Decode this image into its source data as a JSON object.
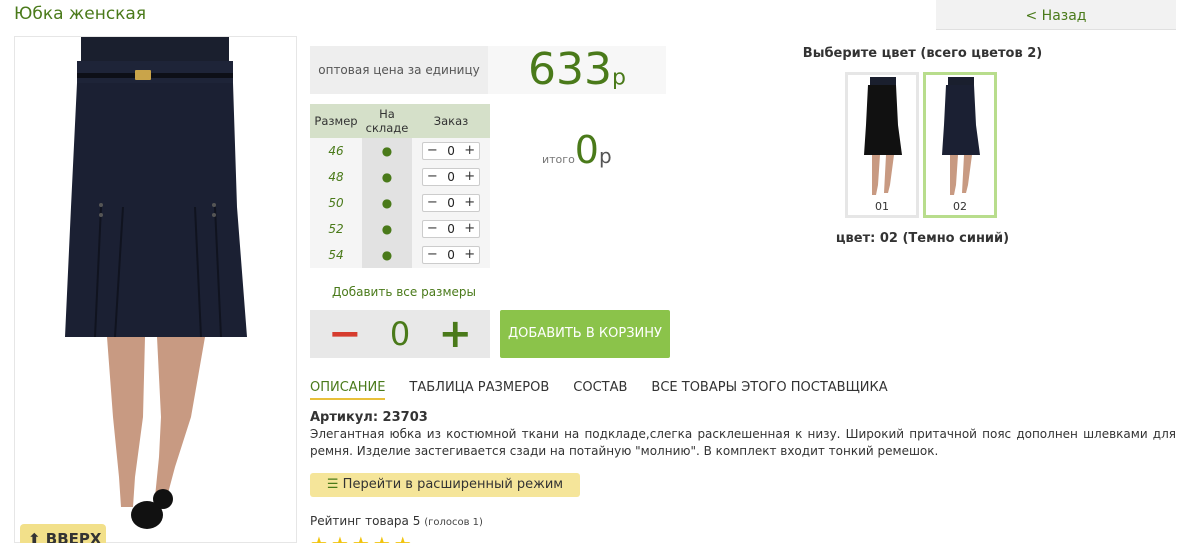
{
  "page": {
    "title": "Юбка женская",
    "back_label": "< Назад",
    "up_label": "⬆ ВВЕРХ"
  },
  "price": {
    "label": "оптовая цена за единицу",
    "value": "633",
    "currency": "р"
  },
  "size_table": {
    "headers": [
      "Размер",
      "На складе",
      "Заказ"
    ],
    "rows": [
      {
        "size": "46",
        "stock": "●",
        "qty": "0"
      },
      {
        "size": "48",
        "stock": "●",
        "qty": "0"
      },
      {
        "size": "50",
        "stock": "●",
        "qty": "0"
      },
      {
        "size": "52",
        "stock": "●",
        "qty": "0"
      },
      {
        "size": "54",
        "stock": "●",
        "qty": "0"
      }
    ],
    "minus": "−",
    "plus": "+"
  },
  "total": {
    "label": "итого",
    "value": "0",
    "currency": "р"
  },
  "order": {
    "add_all_sizes": "Добавить все размеры",
    "qty_minus": "−",
    "qty_value": "0",
    "qty_plus": "+",
    "add_to_cart": "ДОБАВИТЬ В КОРЗИНУ"
  },
  "tabs": [
    {
      "label": "ОПИСАНИЕ",
      "active": true
    },
    {
      "label": "ТАБЛИЦА РАЗМЕРОВ",
      "active": false
    },
    {
      "label": "СОСТАВ",
      "active": false
    },
    {
      "label": "ВСЕ ТОВАРЫ ЭТОГО ПОСТАВЩИКА",
      "active": false
    }
  ],
  "description": {
    "article": "Артикул: 23703",
    "text": "Элегантная юбка из костюмной ткани на подкладе,слегка расклешенная к низу. Широкий притачной пояс дополнен шлевками для ремня. Изделие застегивается сзади на потайную \"молнию\". В комплект входит тонкий ремешок."
  },
  "extended_mode": {
    "icon": "list-icon",
    "label": "Перейти в расширенный режим"
  },
  "rating": {
    "label": "Рейтинг товара 5",
    "votes": "(голосов 1)",
    "stars": 5
  },
  "colors": {
    "title": "Выберите цвет (всего цветов 2)",
    "items": [
      {
        "label": "01",
        "selected": false
      },
      {
        "label": "02",
        "selected": true
      }
    ],
    "selected_label": "цвет: 02 (Темно синий)"
  },
  "palette": {
    "accent_green": "#4a7a1a",
    "button_green": "#8bc34a",
    "minus_red": "#d63c2e",
    "yellow": "#f5e59a",
    "skirt": "#1b2033"
  }
}
